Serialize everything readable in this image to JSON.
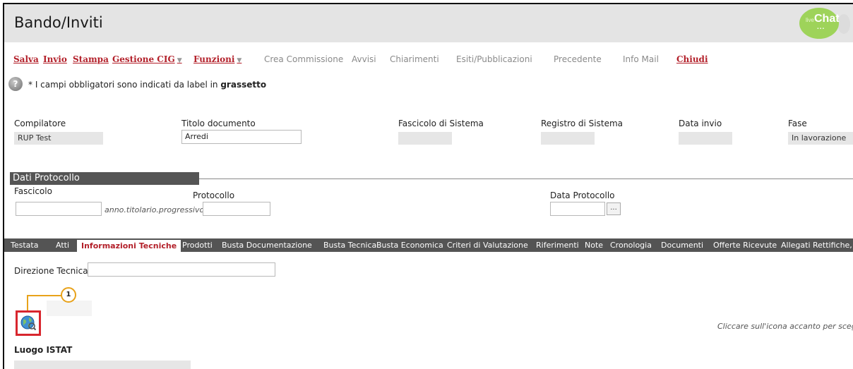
{
  "header": {
    "title": "Bando/Inviti",
    "livechat": {
      "small": "live",
      "big": "Chat",
      "dots": "..."
    }
  },
  "toolbar": {
    "items": [
      {
        "label": "Salva",
        "active": true
      },
      {
        "label": "Invio",
        "active": true
      },
      {
        "label": "Stampa",
        "active": true
      },
      {
        "label": "Gestione CIG",
        "active": true,
        "dropdown": true
      },
      {
        "label": "Funzioni",
        "active": true,
        "dropdown": true
      },
      {
        "label": "Crea Commissione",
        "active": false
      },
      {
        "label": "Avvisi",
        "active": false
      },
      {
        "label": "Chiarimenti",
        "active": false
      },
      {
        "label": "Esiti/Pubblicazioni",
        "active": false
      },
      {
        "label": "Precedente",
        "active": false
      },
      {
        "label": "Info Mail",
        "active": false
      },
      {
        "label": "Chiudi",
        "active": true
      }
    ],
    "caret": "▼"
  },
  "notice": {
    "prefix": "* I campi obbligatori sono indicati da label in ",
    "bold": "grassetto",
    "icon": "help-icon"
  },
  "fields": {
    "compilatore": {
      "label": "Compilatore",
      "value": "RUP Test"
    },
    "titolo": {
      "label": "Titolo documento",
      "value": "Arredi"
    },
    "fascicolo_sistema": {
      "label": "Fascicolo di Sistema",
      "value": ""
    },
    "registro_sistema": {
      "label": "Registro di Sistema",
      "value": ""
    },
    "data_invio": {
      "label": "Data invio",
      "value": ""
    },
    "fase": {
      "label": "Fase",
      "value": "In lavorazione"
    }
  },
  "protocollo": {
    "section_title": "Dati Protocollo",
    "fascicolo": {
      "label": "Fascicolo",
      "value": "",
      "hint": "anno.titolario.progressivo"
    },
    "protocollo": {
      "label": "Protocollo",
      "value": ""
    },
    "data_protocollo": {
      "label": "Data Protocollo",
      "value": "",
      "button": "..."
    }
  },
  "tabs": [
    {
      "label": "Testata"
    },
    {
      "label": "Atti"
    },
    {
      "label": "Informazioni Tecniche",
      "selected": true
    },
    {
      "label": "Prodotti"
    },
    {
      "label": "Busta Documentazione"
    },
    {
      "label": "Busta Tecnica"
    },
    {
      "label": "Busta Economica"
    },
    {
      "label": "Criteri di Valutazione"
    },
    {
      "label": "Riferimenti"
    },
    {
      "label": "Note"
    },
    {
      "label": "Cronologia"
    },
    {
      "label": "Documenti"
    },
    {
      "label": "Offerte Ricevute"
    },
    {
      "label": "Allegati Rettifiche,"
    }
  ],
  "tecniche": {
    "direzione_label": "Direzione Tecnica",
    "direzione_value": "",
    "callout_number": "1",
    "globe_icon": "globe-search-icon",
    "right_hint": "Cliccare sull'icona accanto per sceglier",
    "luogo_label": "Luogo ISTAT",
    "luogo_value": ""
  },
  "colors": {
    "accent": "#b3202a",
    "callout": "#e8a21a",
    "highlight": "#d8262e",
    "tabbar": "#545454"
  }
}
